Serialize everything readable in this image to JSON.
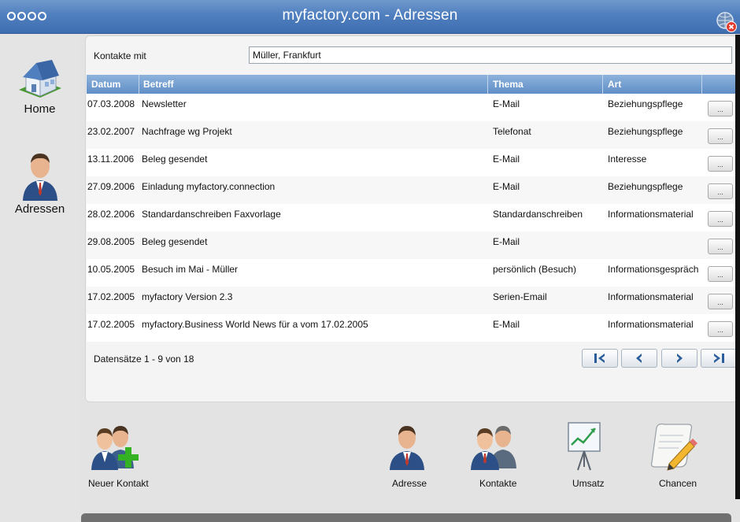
{
  "window": {
    "title": "myfactory.com - Adressen"
  },
  "icons": {
    "menu": "dots-menu-icon",
    "close": "globe-close-icon",
    "home": "house-icon",
    "adressen": "person-icon",
    "first": "first-page-icon",
    "prev": "previous-page-icon",
    "next": "next-page-icon",
    "last": "last-page-icon"
  },
  "colors": {
    "title_bar": "#4f7fbf",
    "grid_header": "#6f99cc",
    "close_badge": "#e03b2e",
    "nav_arrow": "#2a5d9a",
    "add_plus": "#35b224"
  },
  "sidebar": {
    "items": [
      {
        "label": "Home"
      },
      {
        "label": "Adressen"
      }
    ]
  },
  "filter": {
    "label": "Kontakte mit",
    "value": "Müller, Frankfurt"
  },
  "table": {
    "headers": [
      "Datum",
      "Betreff",
      "Thema",
      "Art"
    ],
    "more_label": "...",
    "rows": [
      {
        "datum": "07.03.2008",
        "betreff": "Newsletter",
        "thema": "E-Mail",
        "art": "Beziehungspflege"
      },
      {
        "datum": "23.02.2007",
        "betreff": "Nachfrage wg Projekt",
        "thema": "Telefonat",
        "art": "Beziehungspflege"
      },
      {
        "datum": "13.11.2006",
        "betreff": "Beleg gesendet",
        "thema": "E-Mail",
        "art": "Interesse"
      },
      {
        "datum": "27.09.2006",
        "betreff": "Einladung myfactory.connection",
        "thema": "E-Mail",
        "art": "Beziehungspflege"
      },
      {
        "datum": "28.02.2006",
        "betreff": "Standardanschreiben Faxvorlage",
        "thema": "Standardanschreiben",
        "art": "Informationsmaterial"
      },
      {
        "datum": "29.08.2005",
        "betreff": "Beleg gesendet",
        "thema": "E-Mail",
        "art": ""
      },
      {
        "datum": "10.05.2005",
        "betreff": "Besuch im Mai - Müller",
        "thema": "persönlich (Besuch)",
        "art": "Informationsgespräch"
      },
      {
        "datum": "17.02.2005",
        "betreff": "myfactory Version 2.3",
        "thema": "Serien-Email",
        "art": "Informationsmaterial"
      },
      {
        "datum": "17.02.2005",
        "betreff": "myfactory.Business World News für a vom 17.02.2005",
        "thema": "E-Mail",
        "art": "Informationsmaterial"
      }
    ]
  },
  "pager": {
    "status": "Datensätze 1 - 9 von 18"
  },
  "actions": {
    "neuer_kontakt": "Neuer Kontakt",
    "adresse": "Adresse",
    "kontakte": "Kontakte",
    "umsatz": "Umsatz",
    "chancen": "Chancen"
  }
}
